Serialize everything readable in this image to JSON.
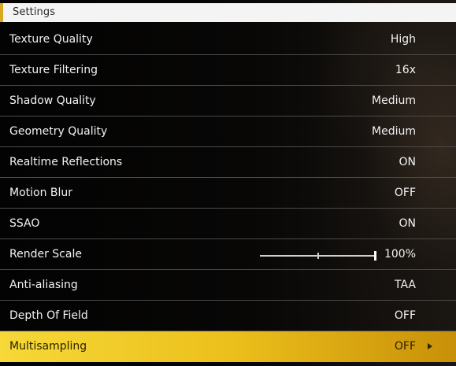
{
  "header": {
    "title": "Settings"
  },
  "settings": [
    {
      "label": "Texture Quality",
      "value": "High"
    },
    {
      "label": "Texture Filtering",
      "value": "16x"
    },
    {
      "label": "Shadow Quality",
      "value": "Medium"
    },
    {
      "label": "Geometry Quality",
      "value": "Medium"
    },
    {
      "label": "Realtime Reflections",
      "value": "ON"
    },
    {
      "label": "Motion Blur",
      "value": "OFF"
    },
    {
      "label": "SSAO",
      "value": "ON"
    },
    {
      "label": "Render Scale",
      "value": "100%",
      "slider_level": 1.0
    },
    {
      "label": "Anti-aliasing",
      "value": "TAA"
    },
    {
      "label": "Depth Of Field",
      "value": "OFF"
    },
    {
      "label": "Multisampling",
      "value": "OFF",
      "selected": true
    }
  ],
  "colors": {
    "accent": "#ecc01c",
    "header_bg": "#f4f4f4",
    "text": "#f2f2f2",
    "divider": "#4a4a4a"
  },
  "icons": {
    "selected_arrow": "arrow-right-icon"
  }
}
